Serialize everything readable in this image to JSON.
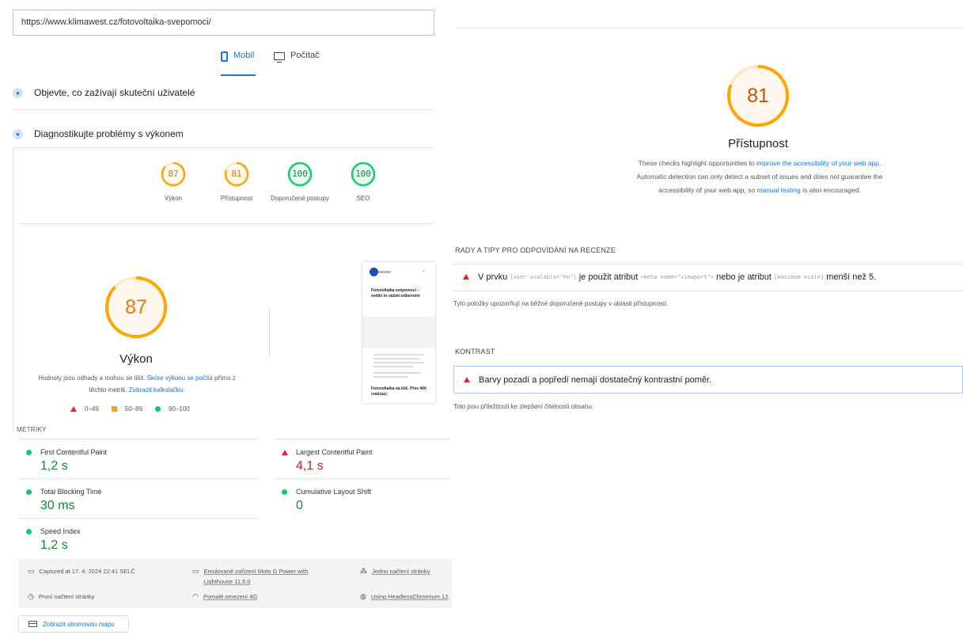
{
  "url": "https://www.klimawest.cz/fotovoltaika-svepomoci/",
  "device_tabs": {
    "mobile": "Mobil",
    "desktop": "Počítač"
  },
  "sections": {
    "real_users": "Objevte, co zažívají skuteční uživatelé",
    "diagnose": "Diagnostikujte problémy s výkonem"
  },
  "scores": [
    {
      "value": "87",
      "label": "Výkon",
      "color": "#ffa400"
    },
    {
      "value": "81",
      "label": "Přístupnost",
      "color": "#ffa400"
    },
    {
      "value": "100",
      "label": "Doporučené postupy",
      "color": "#0cce6b"
    },
    {
      "value": "100",
      "label": "SEO",
      "color": "#0cce6b"
    }
  ],
  "performance": {
    "score": "87",
    "title": "Výkon",
    "desc_start": "Hodnoty jsou odhady a mohou se lišit.",
    "desc_link1": "Skóre výkonu se počítá",
    "desc_mid": "přímo z těchto metrik.",
    "desc_link2": "Zobrazit kalkulačku.",
    "legend": {
      "fail": "0–49",
      "average": "50–89",
      "pass": "90–100"
    }
  },
  "preview": {
    "heading": "Fotovoltaika svépomocí – světlo to vaším odberném",
    "footer": "Fotovoltaika na klíč. Přes 400 realizací."
  },
  "metrics_heading": "METRIKY",
  "metrics": [
    {
      "name": "First Contentful Paint",
      "value": "1,2 s",
      "status": "pass"
    },
    {
      "name": "Largest Contentful Paint",
      "value": "4,1 s",
      "status": "fail"
    },
    {
      "name": "Total Blocking Time",
      "value": "30 ms",
      "status": "pass"
    },
    {
      "name": "Cumulative Layout Shift",
      "value": "0",
      "status": "pass"
    },
    {
      "name": "Speed Index",
      "value": "1,2 s",
      "status": "pass"
    }
  ],
  "info": {
    "captured": "Captured at 17. 4. 2024 22:41 SELČ",
    "device": "Emulované zařízení Moto G Power with Lighthouse 11.5.0",
    "single_load": "Jedno načtení stránky",
    "first_load": "První načtení stránky",
    "throttling": "Pomalé omezení 4G",
    "browser": "Using HeadlessChromium 12"
  },
  "treemap_button": "Zobrazit stromovou mapu",
  "accessibility": {
    "score": "81",
    "title": "Přístupnost",
    "desc_start": "These checks highlight opportunities to",
    "desc_link1": "improve the accessibility of your web app.",
    "desc_mid": "Automatic detection can only detect a subset of issues and does not guarantee the accessibility of your web app, so",
    "desc_link2": "manual testing",
    "desc_end": "is also encouraged."
  },
  "audit_groups": [
    {
      "heading": "RADY A TIPY PRO ODPOVÍDÁNÍ NA RECENZE",
      "audit_prefix": "V prvku",
      "code1": "[user-scalable=\"no\"]",
      "audit_mid": "je použit atribut",
      "code2": "<meta name=\"viewport\">",
      "audit_mid2": "nebo je atribut",
      "code3": "[maximum-scale]",
      "audit_end": "menší než 5.",
      "note": "Tyto položky upozorňují na běžné doporučené postupy v oblasti přístupnosti."
    },
    {
      "heading": "KONTRAST",
      "audit": "Barvy pozadí a popředí nemají dostatečný kontrastní poměr.",
      "note": "Toto jsou příležitosti ke zlepšení čitelnosti obsahu."
    }
  ]
}
